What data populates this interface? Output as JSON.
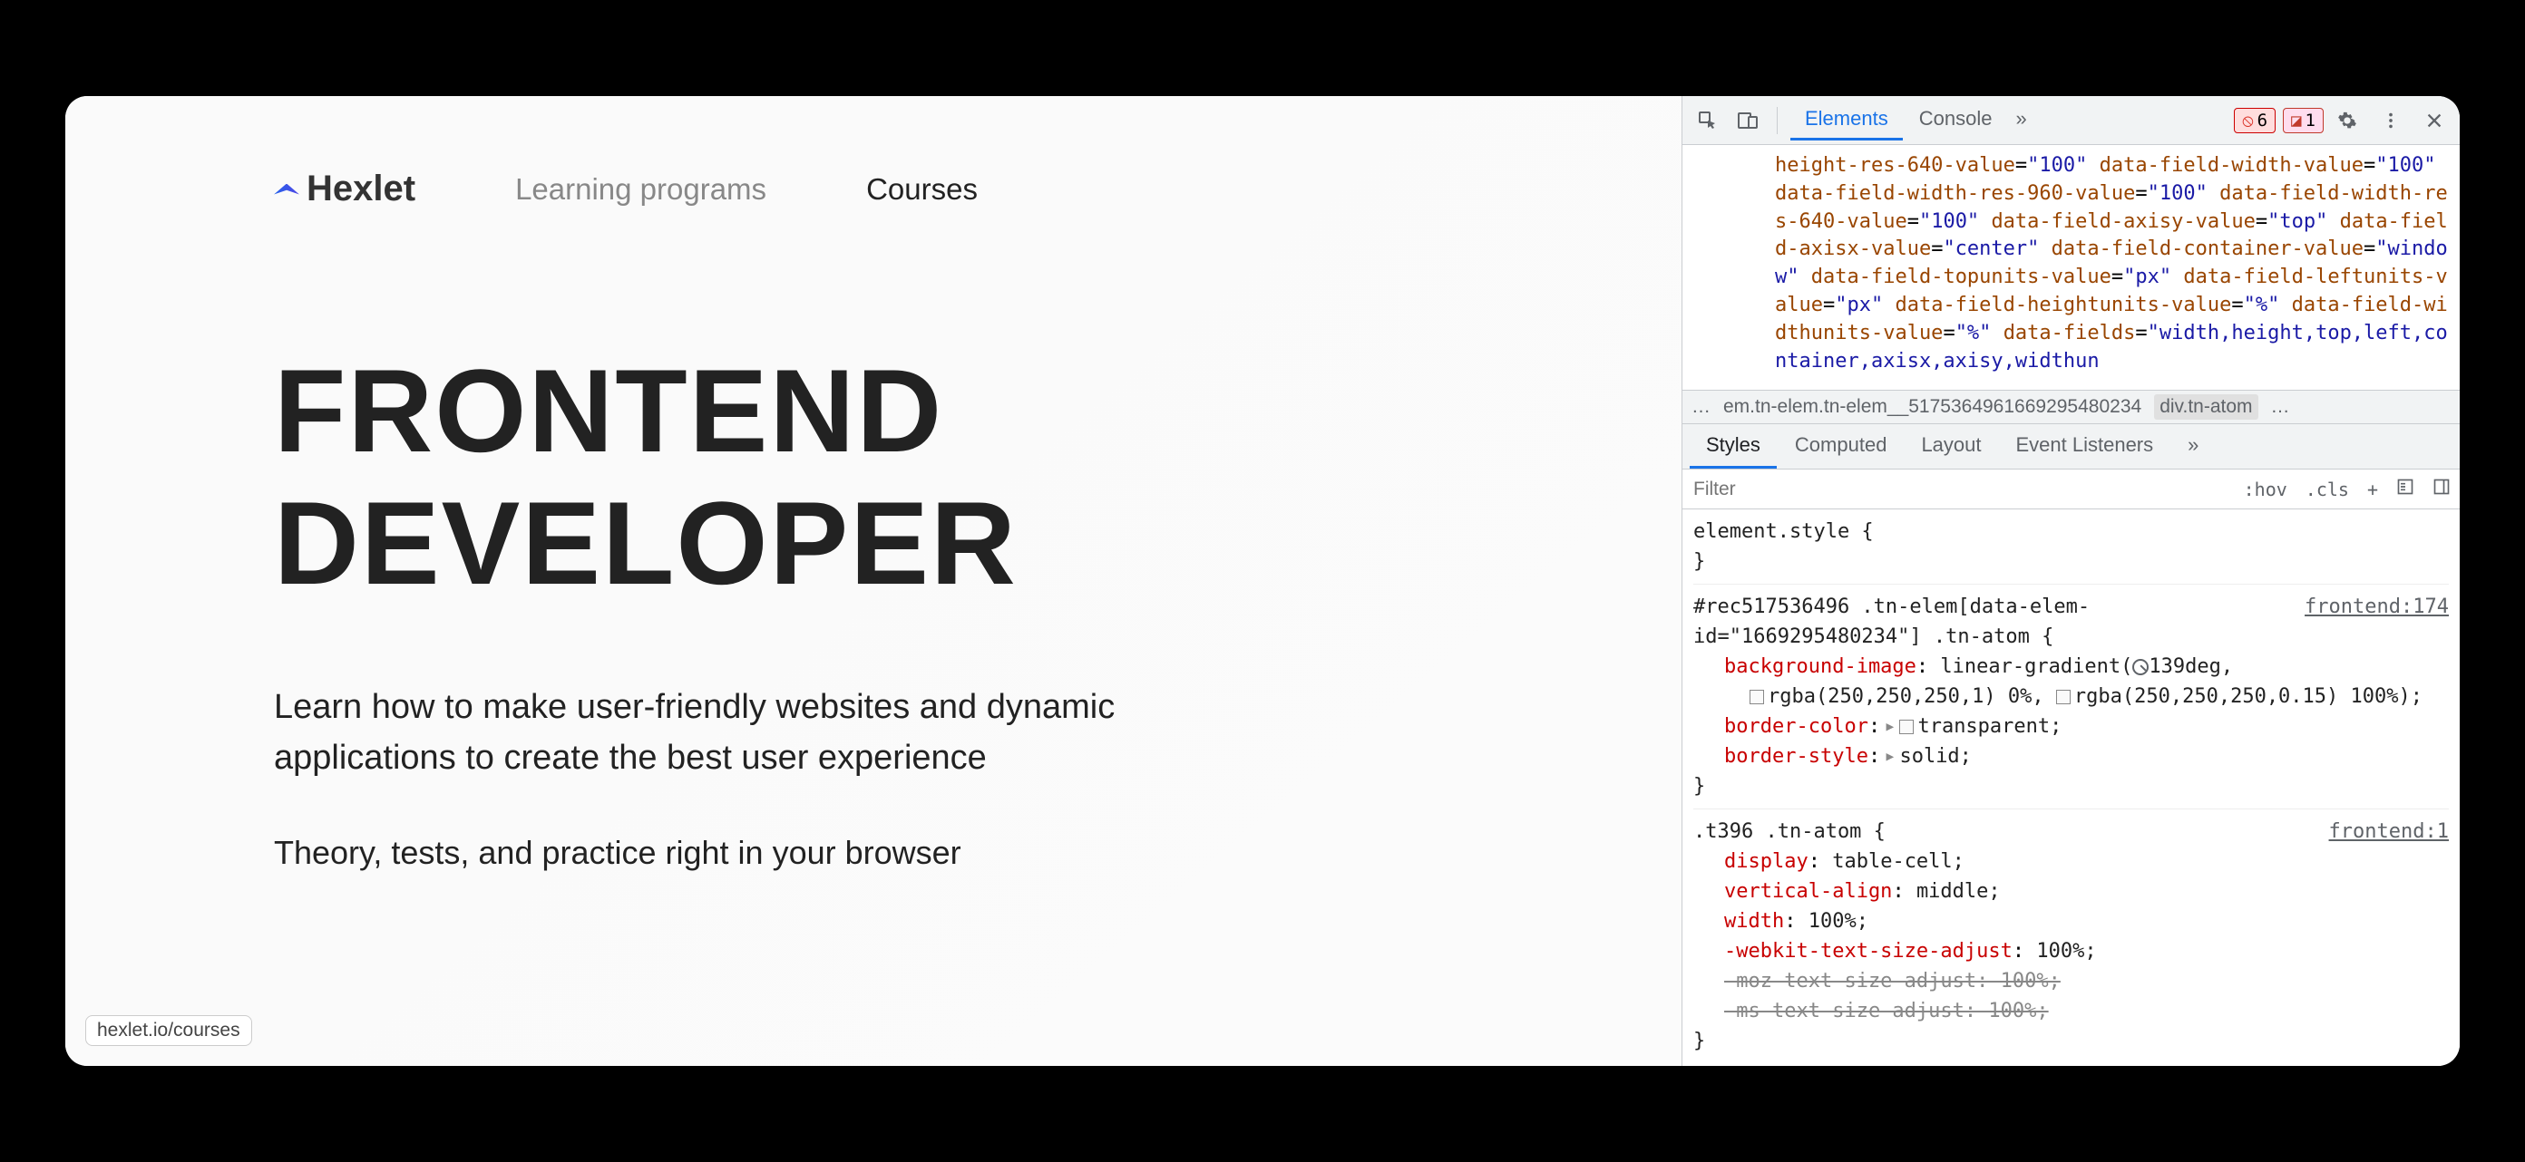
{
  "page": {
    "logo_text": "Hexlet",
    "nav": {
      "link1": "Learning programs",
      "link2": "Courses"
    },
    "hero": {
      "title_line1": "FRONTEND",
      "title_line2": "DEVELOPER",
      "subtitle": "Learn how to make user-friendly websites and dynamic applications to create the best user experience",
      "description": "Theory, tests, and practice right in your browser"
    },
    "url_hint": "hexlet.io/courses"
  },
  "devtools": {
    "tabs": {
      "elements": "Elements",
      "console": "Console"
    },
    "more_glyph": "»",
    "badges": {
      "error_count": "6",
      "issue_count": "1"
    },
    "elements_html": {
      "attrs": [
        {
          "a": "height-res-640-value",
          "v": "100"
        },
        {
          "a": "data-field-width-value",
          "v": "100"
        },
        {
          "a": "data-field-width-res-960-value",
          "v": "100"
        },
        {
          "a": "data-field-width-res-640-value",
          "v": "100"
        },
        {
          "a": "data-field-axisy-value",
          "v": "top"
        },
        {
          "a": "data-field-axisx-value",
          "v": "center"
        },
        {
          "a": "data-field-container-value",
          "v": "window"
        },
        {
          "a": "data-field-topunits-value",
          "v": "px"
        },
        {
          "a": "data-field-leftunits-value",
          "v": "px"
        },
        {
          "a": "data-field-heightunits-value",
          "v": "%"
        },
        {
          "a": "data-field-widthunits-value",
          "v": "%"
        }
      ],
      "trail_attr": "data-fields",
      "trail_val": "width,height,top,left,container,axisx,axisy,widthun"
    },
    "crumbs": {
      "dots": "…",
      "c1": "em.tn-elem.tn-elem__5175364961669295480234",
      "c2": "div.tn-atom",
      "c3": "…"
    },
    "panel_tabs": {
      "styles": "Styles",
      "computed": "Computed",
      "layout": "Layout",
      "listeners": "Event Listeners",
      "more": "»"
    },
    "filter": {
      "placeholder": "Filter",
      "hov": ":hov",
      "cls": ".cls",
      "plus": "+"
    },
    "styles": {
      "rule1": {
        "sel": "element.style {",
        "close": "}"
      },
      "rule2": {
        "sel": "#rec517536496 .tn-elem[data-elem-id=\"1669295480234\"] .tn-atom {",
        "src": "frontend:174",
        "p1": "background-image",
        "v1a": "linear-gradient(",
        "v1b": "139deg,",
        "v1c": "rgba(250,250,250,1) 0%, ",
        "v1d": "rgba(250,250,250,0.15) 100%);",
        "p2": "border-color",
        "v2": "transparent;",
        "p3": "border-style",
        "v3": "solid;",
        "close": "}"
      },
      "rule3": {
        "sel": ".t396 .tn-atom {",
        "src": "frontend:1",
        "p1": "display",
        "v1": "table-cell;",
        "p2": "vertical-align",
        "v2": "middle;",
        "p3": "width",
        "v3": "100%;",
        "p4": "-webkit-text-size-adjust",
        "v4": "100%;",
        "p5s": "-moz-text-size-adjust: 100%;",
        "p6s": "-ms-text-size-adjust: 100%;",
        "close": "}"
      }
    }
  }
}
